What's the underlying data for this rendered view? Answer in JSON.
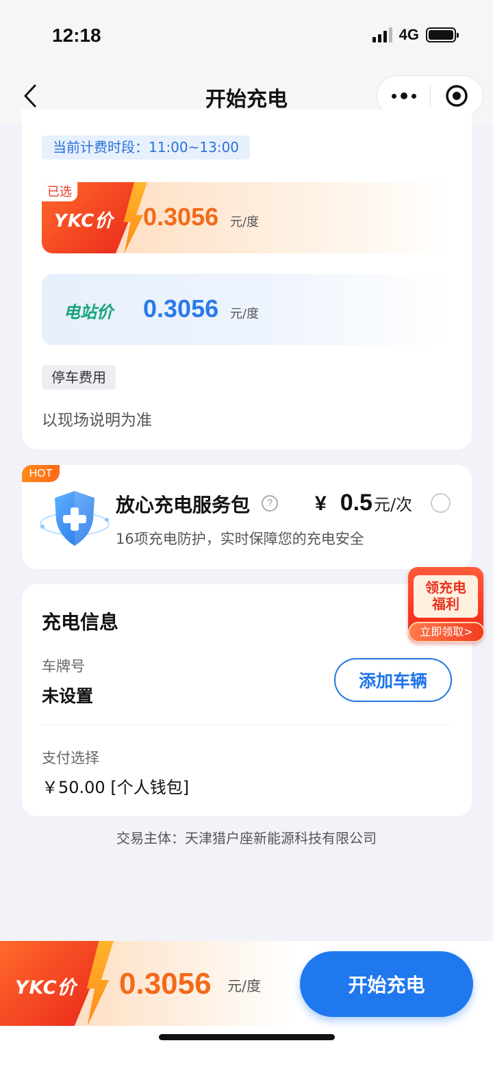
{
  "status_bar": {
    "time": "12:18",
    "network": "4G"
  },
  "nav": {
    "title": "开始充电"
  },
  "pricing": {
    "period_label": "当前计费时段：11:00~13:00",
    "ykc": {
      "selected_tag": "已选",
      "logo_text": "YKC价",
      "price": "0.3056",
      "unit": "元/度"
    },
    "station": {
      "logo_text": "电站价",
      "price": "0.3056",
      "unit": "元/度"
    },
    "parking_tag": "停车费用",
    "parking_note": "以现场说明为准"
  },
  "service": {
    "hot_tag": "HOT",
    "title": "放心充电服务包",
    "help": "?",
    "currency": "¥",
    "amount": "0.5",
    "unit": "元/次",
    "description": "16项充电防护，实时保障您的充电安全"
  },
  "promo": {
    "line1": "领充电",
    "line2": "福利",
    "button": "立即领取>"
  },
  "charge_info": {
    "title": "充电信息",
    "plate_label": "车牌号",
    "plate_value": "未设置",
    "add_vehicle": "添加车辆",
    "payment_label": "支付选择",
    "payment_value": "￥50.00 [个人钱包]"
  },
  "company": "交易主体：天津猎户座新能源科技有限公司",
  "bottom_bar": {
    "logo_text": "YKC价",
    "price": "0.3056",
    "unit": "元/度",
    "start_button": "开始充电"
  },
  "colors": {
    "accent_blue": "#1f78ee",
    "ykc_orange": "#f26a1a",
    "ykc_red": "#e9251a",
    "station_green": "#1aa47a"
  }
}
